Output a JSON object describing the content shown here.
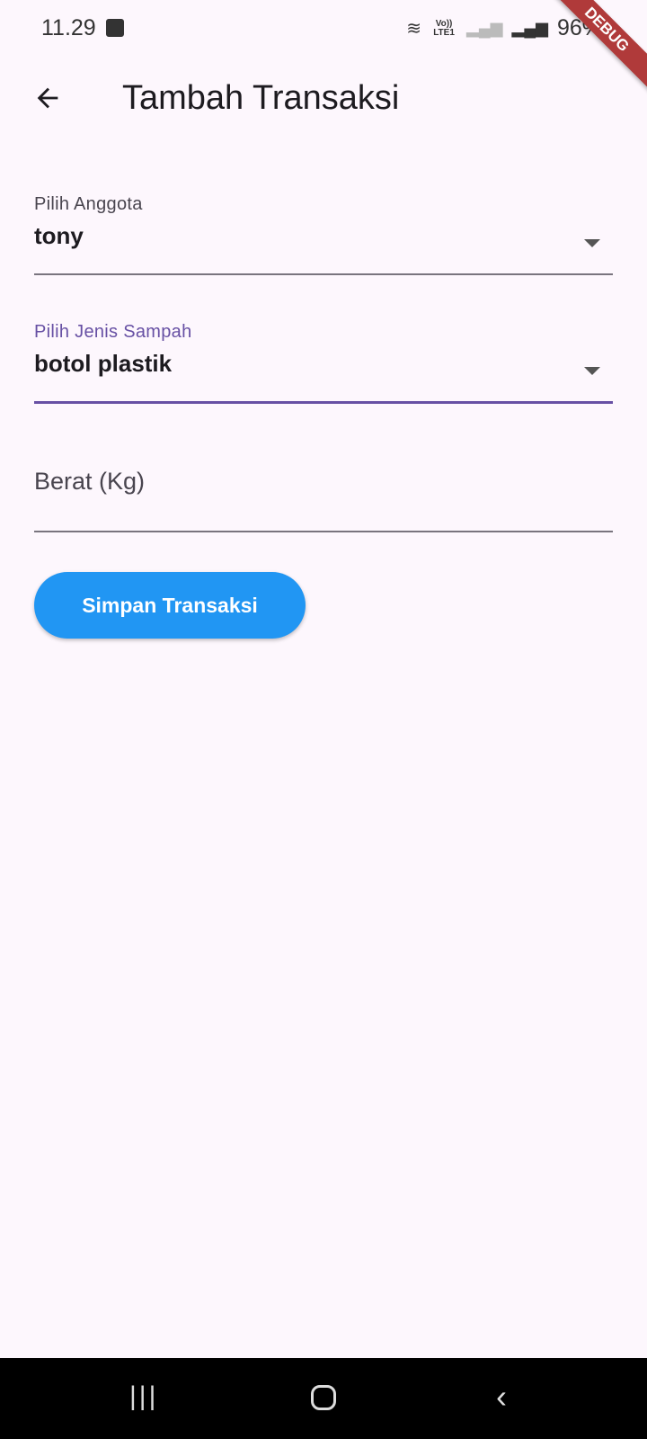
{
  "status_bar": {
    "time": "11.29",
    "network": "Vo)) LTE1",
    "battery": "96%",
    "debug_banner": "DEBUG"
  },
  "app_bar": {
    "title": "Tambah Transaksi",
    "back_icon": "arrow-back-icon"
  },
  "form": {
    "member": {
      "label": "Pilih Anggota",
      "value": "tony"
    },
    "waste_type": {
      "label": "Pilih Jenis Sampah",
      "value": "botol plastik",
      "focused": true
    },
    "weight": {
      "placeholder": "Berat (Kg)",
      "value": ""
    },
    "submit_label": "Simpan Transaksi"
  },
  "colors": {
    "accent": "#6750a4",
    "button": "#2196f3",
    "background": "#fdf7fd"
  }
}
